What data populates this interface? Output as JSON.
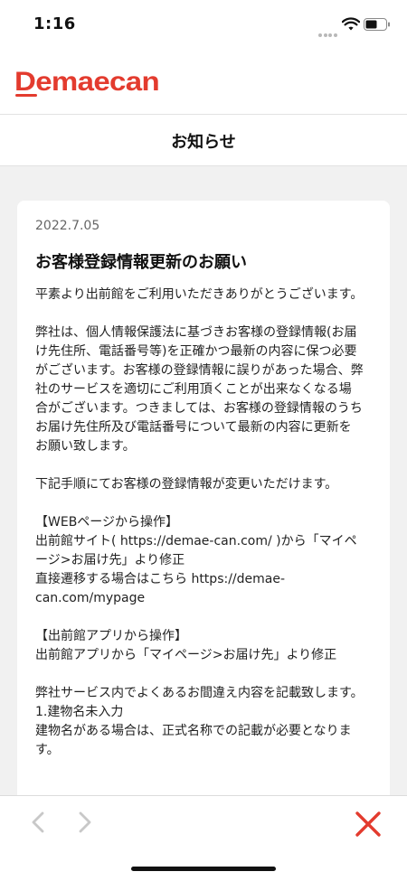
{
  "status_bar": {
    "time": "1:16",
    "icons": [
      "signal-dots-icon",
      "wifi-icon",
      "battery-icon"
    ]
  },
  "header": {
    "logo_text": "Demaecan",
    "brand_color": "#e33b2e"
  },
  "page": {
    "title": "お知らせ"
  },
  "notice": {
    "date": "2022.7.05",
    "title": "お客様登録情報更新のお願い",
    "paragraphs": [
      "平素より出前館をご利用いただきありがとうございます。",
      "弊社は、個人情報保護法に基づきお客様の登録情報(お届\nけ先住所、電話番号等)を正確かつ最新の内容に保つ必要\nがございます。お客様の登録情報に誤りがあった場合、弊\n社のサービスを適切にご利用頂くことが出来なくなる場\n合がございます。つきましては、お客様の登録情報のうち\nお届け先住所及び電話番号について最新の内容に更新を\nお願い致します。",
      "下記手順にてお客様の登録情報が変更いただけます。",
      "【WEBページから操作】\n出前館サイト( https://demae-can.com/ )から「マイペ\nージ>お届け先」より修正\n直接遷移する場合はこちら https://demae-\ncan.com/mypage",
      "【出前館アプリから操作】\n出前館アプリから「マイページ>お届け先」より修正",
      "弊社サービス内でよくあるお間違え内容を記載致します。\n1.建物名未入力\n建物名がある場合は、正式名称での記載が必要となりま\nす。"
    ]
  },
  "bottom_bar": {
    "back_icon": "chevron-left-icon",
    "forward_icon": "chevron-right-icon",
    "close_icon": "close-icon",
    "close_color": "#e33b2e",
    "disabled_color": "#c8c8c8"
  }
}
